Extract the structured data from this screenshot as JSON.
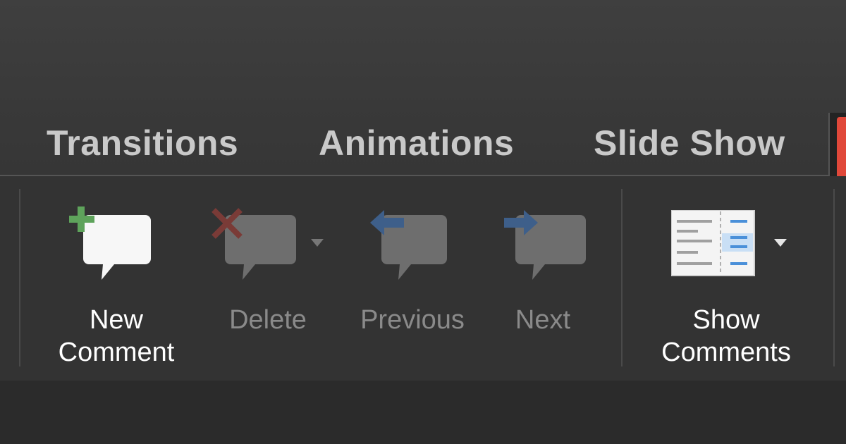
{
  "tabs": {
    "transitions": "Transitions",
    "animations": "Animations",
    "slide_show": "Slide Show"
  },
  "ribbon": {
    "new_comment": {
      "line1": "New",
      "line2": "Comment",
      "enabled": true
    },
    "delete": {
      "label": "Delete",
      "enabled": false
    },
    "previous": {
      "label": "Previous",
      "enabled": false
    },
    "next": {
      "label": "Next",
      "enabled": false
    },
    "show_comments": {
      "line1": "Show",
      "line2": "Comments",
      "enabled": true
    }
  },
  "colors": {
    "accent_tab": "#e0483a",
    "plus_green": "#5ea35b",
    "delete_red": "#7a3b37",
    "arrow_blue": "#3e5f8a",
    "comments_blue": "#4a90d9"
  },
  "icons": [
    "new-comment-icon",
    "delete-comment-icon",
    "previous-comment-icon",
    "next-comment-icon",
    "show-comments-icon"
  ]
}
